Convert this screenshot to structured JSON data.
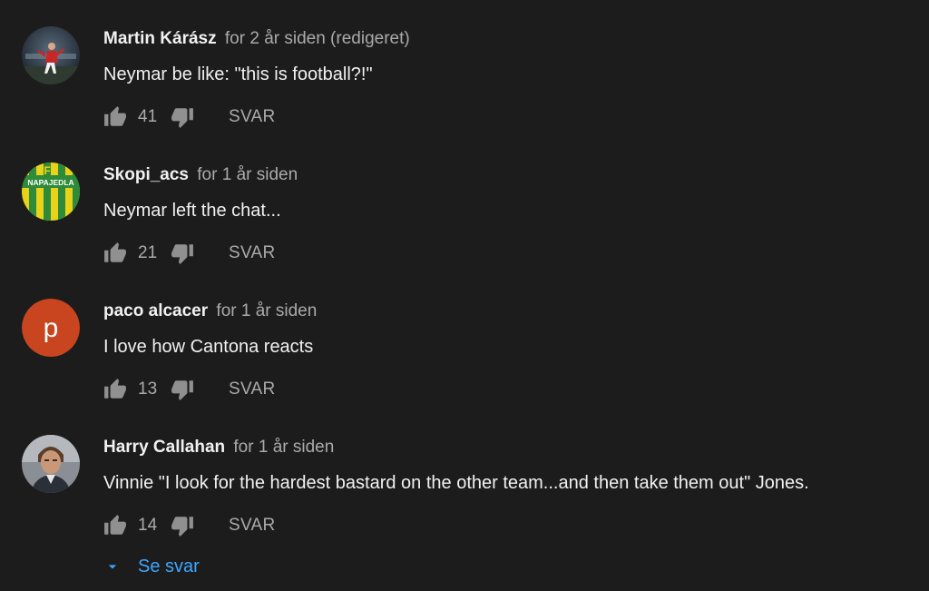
{
  "comments": [
    {
      "author": "Martin Kárász",
      "time": "for 2 år siden (redigeret)",
      "text": "Neymar be like: \"this is football?!\"",
      "likes": "41",
      "reply_label": "SVAR",
      "avatar": "football-player-photo"
    },
    {
      "author": "Skopi_acs",
      "time": "for 1 år siden",
      "text": "Neymar left the chat...",
      "likes": "21",
      "reply_label": "SVAR",
      "avatar": "club-badge",
      "avatar_text": "NAPAJEDLA",
      "avatar_badge_letters": "FS"
    },
    {
      "author": "paco alcacer",
      "time": "for 1 år siden",
      "text": "I love how Cantona reacts",
      "likes": "13",
      "reply_label": "SVAR",
      "avatar": "letter",
      "avatar_letter": "p",
      "avatar_color": "#c8451f"
    },
    {
      "author": "Harry Callahan",
      "time": "for 1 år siden",
      "text": "Vinnie \"I look for the hardest bastard on the other team...and then take them out\" Jones.",
      "likes": "14",
      "reply_label": "SVAR",
      "avatar": "portrait-photo"
    }
  ],
  "show_replies": {
    "label": "Se svar",
    "icon": "caret-down-icon"
  },
  "colors": {
    "background": "#1c1c1c",
    "primary_text": "#f1f1f1",
    "secondary_text": "#aaaaaa",
    "link": "#3ea6ff"
  }
}
